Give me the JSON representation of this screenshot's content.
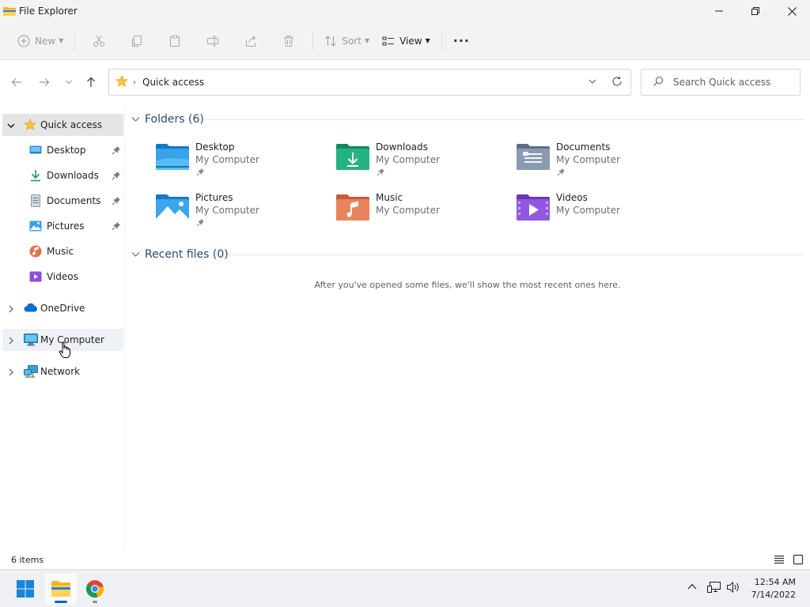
{
  "window": {
    "title": "File Explorer"
  },
  "toolbar": {
    "new_label": "New",
    "sort_label": "Sort",
    "view_label": "View",
    "more_label": "···"
  },
  "address": {
    "crumb_sep": "›",
    "crumb": "Quick access",
    "search_placeholder": "Search Quick access"
  },
  "sidebar": {
    "items": [
      {
        "label": "Quick access",
        "icon": "star-icon"
      },
      {
        "label": "Desktop",
        "icon": "desktop-icon"
      },
      {
        "label": "Downloads",
        "icon": "download-icon"
      },
      {
        "label": "Documents",
        "icon": "document-icon"
      },
      {
        "label": "Pictures",
        "icon": "picture-icon"
      },
      {
        "label": "Music",
        "icon": "music-icon"
      },
      {
        "label": "Videos",
        "icon": "video-icon"
      },
      {
        "label": "OneDrive",
        "icon": "cloud-icon"
      },
      {
        "label": "My Computer",
        "icon": "computer-icon"
      },
      {
        "label": "Network",
        "icon": "network-icon"
      }
    ]
  },
  "main": {
    "folders_heading": "Folders (6)",
    "folders": [
      {
        "name": "Desktop",
        "location": "My Computer",
        "pinned": true,
        "icon": "desktop-folder-icon"
      },
      {
        "name": "Downloads",
        "location": "My Computer",
        "pinned": true,
        "icon": "downloads-folder-icon"
      },
      {
        "name": "Documents",
        "location": "My Computer",
        "pinned": true,
        "icon": "documents-folder-icon"
      },
      {
        "name": "Pictures",
        "location": "My Computer",
        "pinned": true,
        "icon": "pictures-folder-icon"
      },
      {
        "name": "Music",
        "location": "My Computer",
        "pinned": false,
        "icon": "music-folder-icon"
      },
      {
        "name": "Videos",
        "location": "My Computer",
        "pinned": false,
        "icon": "videos-folder-icon"
      }
    ],
    "recent_heading": "Recent files (0)",
    "recent_empty": "After you've opened some files, we'll show the most recent ones here."
  },
  "status": {
    "item_count": "6 items"
  },
  "taskbar": {
    "time": "12:54 AM",
    "date": "7/14/2022"
  },
  "colors": {
    "accent": "#0067c0",
    "heading": "#2b4a78",
    "selected_bg": "#e5e5e5"
  }
}
